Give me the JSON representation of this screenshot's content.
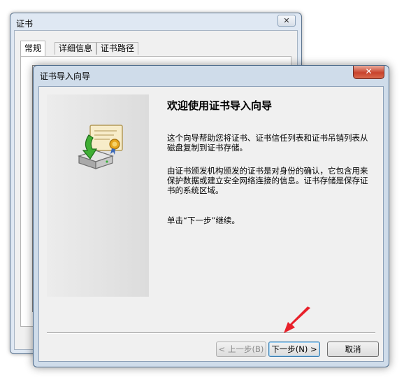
{
  "cert_window": {
    "title": "证书",
    "close_glyph": "✕",
    "tabs": [
      {
        "label": "常规"
      },
      {
        "label": "详细信息"
      },
      {
        "label": "证书路径"
      }
    ]
  },
  "wizard": {
    "title": "证书导入向导",
    "close_glyph": "✕",
    "heading": "欢迎使用证书导入向导",
    "paragraphs": [
      "这个向导帮助您将证书、证书信任列表和证书吊销列表从磁盘复制到证书存储。",
      "由证书颁发机构颁发的证书是对身份的确认，它包含用来保护数据或建立安全网络连接的信息。证书存储是保存证书的系统区域。",
      "单击“下一步”继续。"
    ],
    "buttons": {
      "back": "< 上一步(B)",
      "next": "下一步(N) >",
      "cancel": "取消"
    },
    "icon": "certificate-import-icon"
  },
  "colors": {
    "arrow": "#e8202a",
    "close_button": "#c8432c"
  }
}
